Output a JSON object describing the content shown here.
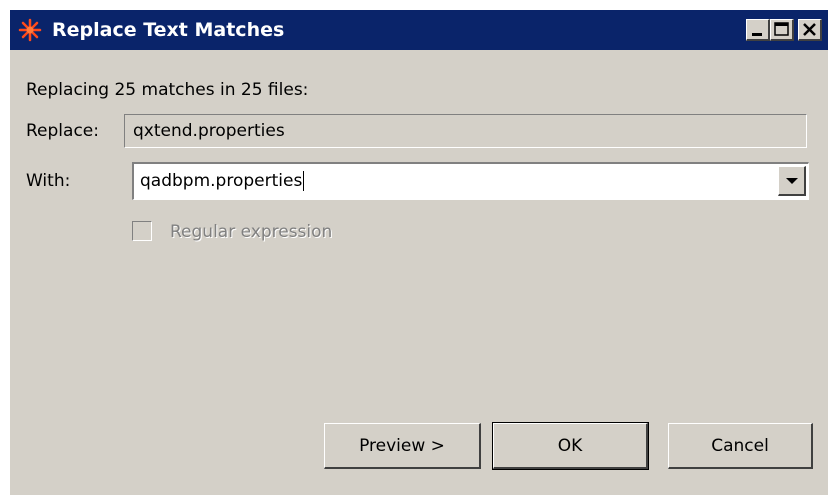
{
  "window": {
    "title": "Replace Text Matches",
    "icon": "replace-icon",
    "controls": {
      "minimize_icon": "minimize-icon",
      "maximize_icon": "maximize-icon",
      "close_icon": "close-icon"
    }
  },
  "form": {
    "summary": "Replacing 25 matches in 25 files:",
    "replace_label": "Replace:",
    "replace_value": "qxtend.properties",
    "with_label": "With:",
    "with_value": "qadbpm.properties",
    "regex_label": "Regular expression",
    "regex_checked": false,
    "regex_enabled": false
  },
  "buttons": {
    "preview": "Preview >",
    "ok": "OK",
    "cancel": "Cancel"
  },
  "colors": {
    "titlebar": "#0a246a",
    "dialog_bg": "#d4d0c8",
    "icon_accent": "#ff4a1a"
  }
}
